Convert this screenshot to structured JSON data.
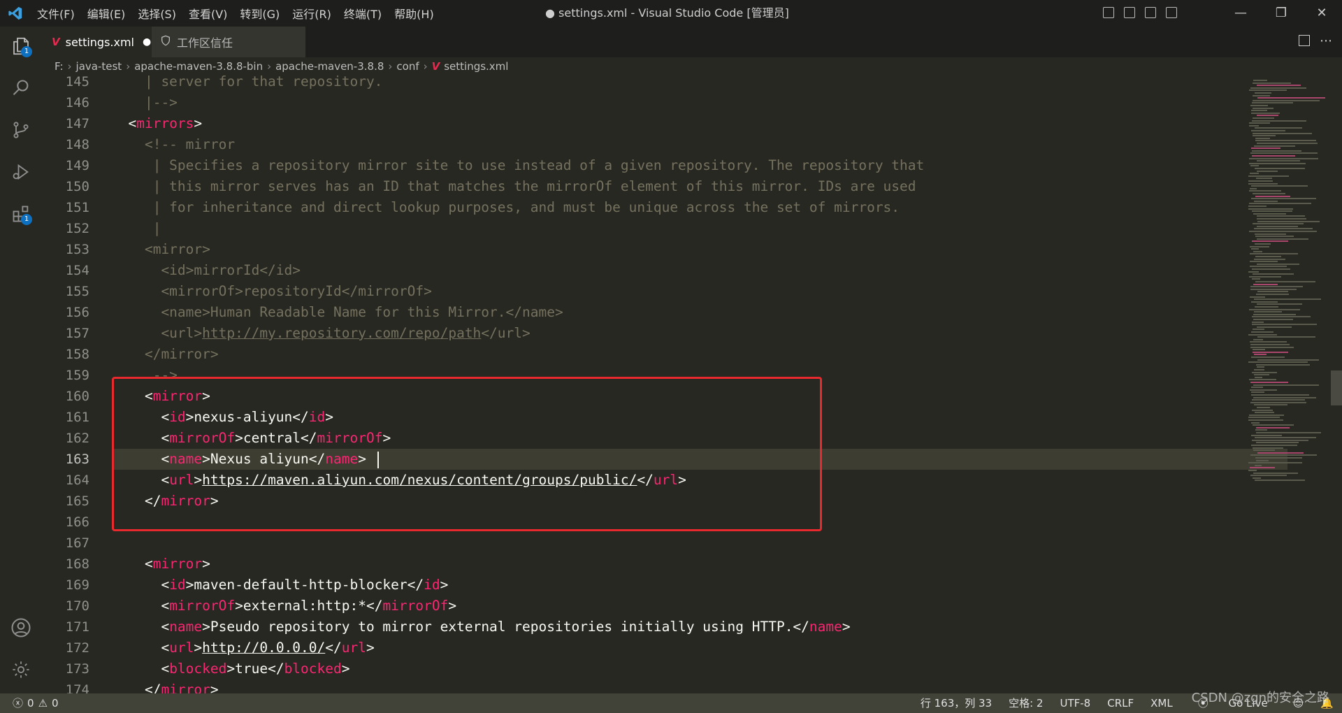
{
  "titlebar": {
    "menu": [
      "文件(F)",
      "编辑(E)",
      "选择(S)",
      "查看(V)",
      "转到(G)",
      "运行(R)",
      "终端(T)",
      "帮助(H)"
    ],
    "title": "● settings.xml - Visual Studio Code [管理员]",
    "window_controls": [
      "—",
      "❐",
      "✕"
    ]
  },
  "activity_bar": {
    "explorer_badge": "1",
    "extensions_badge": "1"
  },
  "tabs": [
    {
      "label": "settings.xml",
      "dirty": "●"
    },
    {
      "label": "工作区信任"
    }
  ],
  "breadcrumb": [
    "F:",
    "java-test",
    "apache-maven-3.8.8-bin",
    "apache-maven-3.8.8",
    "conf",
    "settings.xml"
  ],
  "editor": {
    "current_line": 163
  },
  "lines": [
    {
      "n": "145",
      "parts": [
        [
          "cm",
          "    | server for that repository."
        ]
      ]
    },
    {
      "n": "146",
      "parts": [
        [
          "cm",
          "    |-->"
        ]
      ]
    },
    {
      "n": "147",
      "parts": [
        [
          "pl",
          "  <"
        ],
        [
          "tg",
          "mirrors"
        ],
        [
          "pl",
          ">"
        ]
      ]
    },
    {
      "n": "148",
      "parts": [
        [
          "cm",
          "    <!-- mirror"
        ]
      ]
    },
    {
      "n": "149",
      "parts": [
        [
          "cm",
          "     | Specifies a repository mirror site to use instead of a given repository. The repository that"
        ]
      ]
    },
    {
      "n": "150",
      "parts": [
        [
          "cm",
          "     | this mirror serves has an ID that matches the mirrorOf element of this mirror. IDs are used"
        ]
      ]
    },
    {
      "n": "151",
      "parts": [
        [
          "cm",
          "     | for inheritance and direct lookup purposes, and must be unique across the set of mirrors."
        ]
      ]
    },
    {
      "n": "152",
      "parts": [
        [
          "cm",
          "     |"
        ]
      ]
    },
    {
      "n": "153",
      "parts": [
        [
          "cm",
          "    <mirror>"
        ]
      ]
    },
    {
      "n": "154",
      "parts": [
        [
          "cm",
          "      <id>mirrorId</id>"
        ]
      ]
    },
    {
      "n": "155",
      "parts": [
        [
          "cm",
          "      <mirrorOf>repositoryId</mirrorOf>"
        ]
      ]
    },
    {
      "n": "156",
      "parts": [
        [
          "cm",
          "      <name>Human Readable Name for this Mirror.</name>"
        ]
      ]
    },
    {
      "n": "157",
      "parts": [
        [
          "cm",
          "      <url>"
        ],
        [
          "cm ul",
          "http://my.repository.com/repo/path"
        ],
        [
          "cm",
          "</url>"
        ]
      ]
    },
    {
      "n": "158",
      "parts": [
        [
          "cm",
          "    </mirror>"
        ]
      ]
    },
    {
      "n": "159",
      "parts": [
        [
          "cm",
          "     -->"
        ]
      ]
    },
    {
      "n": "160",
      "parts": [
        [
          "pl",
          "    <"
        ],
        [
          "tg",
          "mirror"
        ],
        [
          "pl",
          ">"
        ]
      ]
    },
    {
      "n": "161",
      "parts": [
        [
          "pl",
          "      <"
        ],
        [
          "tg",
          "id"
        ],
        [
          "pl",
          ">nexus-aliyun</"
        ],
        [
          "tg",
          "id"
        ],
        [
          "pl",
          ">"
        ]
      ]
    },
    {
      "n": "162",
      "parts": [
        [
          "pl",
          "      <"
        ],
        [
          "tg",
          "mirrorOf"
        ],
        [
          "pl",
          ">central</"
        ],
        [
          "tg",
          "mirrorOf"
        ],
        [
          "pl",
          ">"
        ]
      ]
    },
    {
      "n": "163",
      "parts": [
        [
          "pl",
          "      <"
        ],
        [
          "tg",
          "name"
        ],
        [
          "pl",
          ">Nexus aliyun</"
        ],
        [
          "tg",
          "name"
        ],
        [
          "pl",
          "> "
        ]
      ]
    },
    {
      "n": "164",
      "parts": [
        [
          "pl",
          "      <"
        ],
        [
          "tg",
          "url"
        ],
        [
          "pl",
          ">"
        ],
        [
          "pl ul",
          "https://maven.aliyun.com/nexus/content/groups/public/"
        ],
        [
          "pl",
          "</"
        ],
        [
          "tg",
          "url"
        ],
        [
          "pl",
          ">"
        ]
      ]
    },
    {
      "n": "165",
      "parts": [
        [
          "pl",
          "    </"
        ],
        [
          "tg",
          "mirror"
        ],
        [
          "pl",
          ">"
        ]
      ]
    },
    {
      "n": "166",
      "parts": []
    },
    {
      "n": "167",
      "parts": []
    },
    {
      "n": "168",
      "parts": [
        [
          "pl",
          "    <"
        ],
        [
          "tg",
          "mirror"
        ],
        [
          "pl",
          ">"
        ]
      ]
    },
    {
      "n": "169",
      "parts": [
        [
          "pl",
          "      <"
        ],
        [
          "tg",
          "id"
        ],
        [
          "pl",
          ">maven-default-http-blocker</"
        ],
        [
          "tg",
          "id"
        ],
        [
          "pl",
          ">"
        ]
      ]
    },
    {
      "n": "170",
      "parts": [
        [
          "pl",
          "      <"
        ],
        [
          "tg",
          "mirrorOf"
        ],
        [
          "pl",
          ">external:http:*</"
        ],
        [
          "tg",
          "mirrorOf"
        ],
        [
          "pl",
          ">"
        ]
      ]
    },
    {
      "n": "171",
      "parts": [
        [
          "pl",
          "      <"
        ],
        [
          "tg",
          "name"
        ],
        [
          "pl",
          ">Pseudo repository to mirror external repositories initially using HTTP.</"
        ],
        [
          "tg",
          "name"
        ],
        [
          "pl",
          ">"
        ]
      ]
    },
    {
      "n": "172",
      "parts": [
        [
          "pl",
          "      <"
        ],
        [
          "tg",
          "url"
        ],
        [
          "pl",
          ">"
        ],
        [
          "pl ul",
          "http://0.0.0.0/"
        ],
        [
          "pl",
          "</"
        ],
        [
          "tg",
          "url"
        ],
        [
          "pl",
          ">"
        ]
      ]
    },
    {
      "n": "173",
      "parts": [
        [
          "pl",
          "      <"
        ],
        [
          "tg",
          "blocked"
        ],
        [
          "pl",
          ">true</"
        ],
        [
          "tg",
          "blocked"
        ],
        [
          "pl",
          ">"
        ]
      ]
    },
    {
      "n": "174",
      "parts": [
        [
          "pl",
          "    </"
        ],
        [
          "tg",
          "mirror"
        ],
        [
          "pl",
          ">"
        ]
      ]
    }
  ],
  "statusbar": {
    "errors": "0",
    "warnings": "0",
    "position": "行 163，列 33",
    "spaces": "空格: 2",
    "encoding": "UTF-8",
    "eol": "CRLF",
    "language": "XML",
    "golive": "Go Live"
  },
  "watermark": "CSDN @zgn的安全之路",
  "colors": {
    "tag": "#f92672",
    "comment": "#75715e",
    "text": "#f8f8f2",
    "highlight_box": "#e8292e"
  }
}
